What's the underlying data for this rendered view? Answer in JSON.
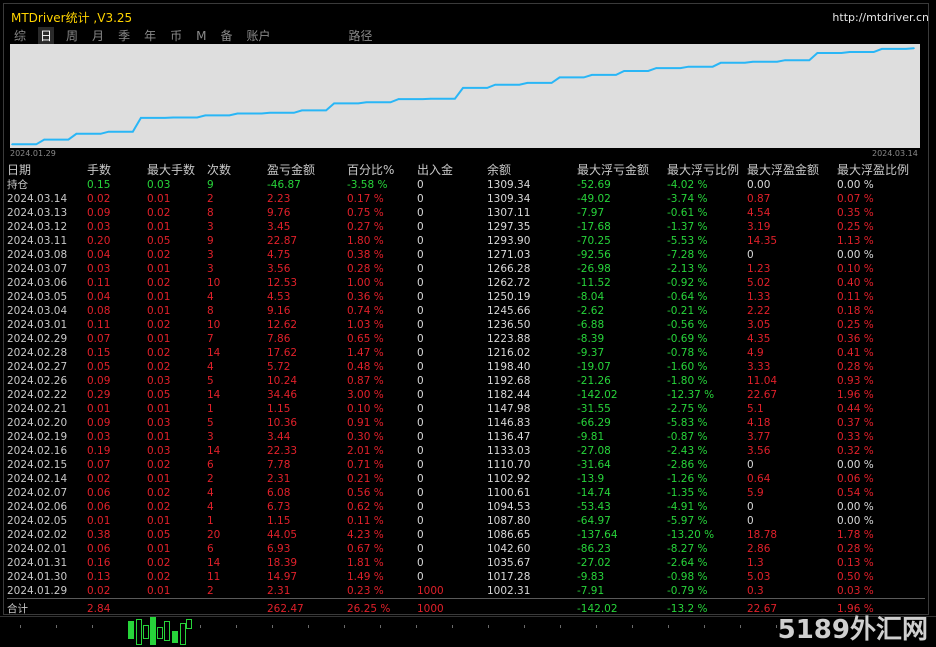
{
  "app": {
    "title": "MTDriver统计 ,V3.25",
    "url": "http://mtdriver.cn"
  },
  "tabs": [
    {
      "label": "综",
      "active": false
    },
    {
      "label": "日",
      "active": true
    },
    {
      "label": "周",
      "active": false
    },
    {
      "label": "月",
      "active": false
    },
    {
      "label": "季",
      "active": false
    },
    {
      "label": "年",
      "active": false
    },
    {
      "label": "币",
      "active": false
    },
    {
      "label": "M",
      "active": false
    },
    {
      "label": "备",
      "active": false
    },
    {
      "label": "账户",
      "active": false
    },
    {
      "label": "路径",
      "active": false
    }
  ],
  "chart": {
    "start_label": "2024.01.29",
    "end_label": "2024.03.14",
    "line_color": "#29b6f6"
  },
  "chart_data": {
    "type": "line",
    "x": [
      "2024.01.29",
      "2024.01.30",
      "2024.01.31",
      "2024.02.01",
      "2024.02.02",
      "2024.02.05",
      "2024.02.06",
      "2024.02.07",
      "2024.02.14",
      "2024.02.15",
      "2024.02.16",
      "2024.02.19",
      "2024.02.20",
      "2024.02.21",
      "2024.02.22",
      "2024.02.26",
      "2024.02.27",
      "2024.02.28",
      "2024.02.29",
      "2024.03.01",
      "2024.03.04",
      "2024.03.05",
      "2024.03.06",
      "2024.03.07",
      "2024.03.08",
      "2024.03.11",
      "2024.03.12",
      "2024.03.13",
      "2024.03.14"
    ],
    "series": [
      {
        "values": [
          1002.31,
          1017.28,
          1035.67,
          1042.6,
          1086.65,
          1087.8,
          1094.53,
          1100.61,
          1102.92,
          1110.7,
          1133.03,
          1136.47,
          1146.83,
          1147.98,
          1182.44,
          1192.68,
          1198.4,
          1216.02,
          1223.88,
          1236.5,
          1245.66,
          1250.19,
          1262.72,
          1266.28,
          1271.03,
          1293.9,
          1297.35,
          1307.11,
          1309.34
        ]
      }
    ]
  },
  "columns": [
    "日期",
    "手数",
    "最大手数",
    "次数",
    "盈亏金额",
    "百分比%",
    "出入金",
    "余额",
    "最大浮亏金额",
    "最大浮亏比例",
    "最大浮盈金额",
    "最大浮盈比例"
  ],
  "colors": {
    "red": "#e0202a",
    "green": "#27d43a",
    "white": "#d8d8d8"
  },
  "holding": [
    "持仓",
    "0.15",
    "0.03",
    "9",
    "-46.87",
    "-3.58 %",
    "0",
    "1309.34",
    "-52.69",
    "-4.02 %",
    "0.00",
    "0.00 %"
  ],
  "rows": [
    [
      "2024.03.14",
      "0.02",
      "0.01",
      "2",
      "2.23",
      "0.17 %",
      "0",
      "1309.34",
      "-49.02",
      "-3.74 %",
      "0.87",
      "0.07 %"
    ],
    [
      "2024.03.13",
      "0.09",
      "0.02",
      "8",
      "9.76",
      "0.75 %",
      "0",
      "1307.11",
      "-7.97",
      "-0.61 %",
      "4.54",
      "0.35 %"
    ],
    [
      "2024.03.12",
      "0.03",
      "0.01",
      "3",
      "3.45",
      "0.27 %",
      "0",
      "1297.35",
      "-17.68",
      "-1.37 %",
      "3.19",
      "0.25 %"
    ],
    [
      "2024.03.11",
      "0.20",
      "0.05",
      "9",
      "22.87",
      "1.80 %",
      "0",
      "1293.90",
      "-70.25",
      "-5.53 %",
      "14.35",
      "1.13 %"
    ],
    [
      "2024.03.08",
      "0.04",
      "0.02",
      "3",
      "4.75",
      "0.38 %",
      "0",
      "1271.03",
      "-92.56",
      "-7.28 %",
      "0",
      "0.00 %"
    ],
    [
      "2024.03.07",
      "0.03",
      "0.01",
      "3",
      "3.56",
      "0.28 %",
      "0",
      "1266.28",
      "-26.98",
      "-2.13 %",
      "1.23",
      "0.10 %"
    ],
    [
      "2024.03.06",
      "0.11",
      "0.02",
      "10",
      "12.53",
      "1.00 %",
      "0",
      "1262.72",
      "-11.52",
      "-0.92 %",
      "5.02",
      "0.40 %"
    ],
    [
      "2024.03.05",
      "0.04",
      "0.01",
      "4",
      "4.53",
      "0.36 %",
      "0",
      "1250.19",
      "-8.04",
      "-0.64 %",
      "1.33",
      "0.11 %"
    ],
    [
      "2024.03.04",
      "0.08",
      "0.01",
      "8",
      "9.16",
      "0.74 %",
      "0",
      "1245.66",
      "-2.62",
      "-0.21 %",
      "2.22",
      "0.18 %"
    ],
    [
      "2024.03.01",
      "0.11",
      "0.02",
      "10",
      "12.62",
      "1.03 %",
      "0",
      "1236.50",
      "-6.88",
      "-0.56 %",
      "3.05",
      "0.25 %"
    ],
    [
      "2024.02.29",
      "0.07",
      "0.01",
      "7",
      "7.86",
      "0.65 %",
      "0",
      "1223.88",
      "-8.39",
      "-0.69 %",
      "4.35",
      "0.36 %"
    ],
    [
      "2024.02.28",
      "0.15",
      "0.02",
      "14",
      "17.62",
      "1.47 %",
      "0",
      "1216.02",
      "-9.37",
      "-0.78 %",
      "4.9",
      "0.41 %"
    ],
    [
      "2024.02.27",
      "0.05",
      "0.02",
      "4",
      "5.72",
      "0.48 %",
      "0",
      "1198.40",
      "-19.07",
      "-1.60 %",
      "3.33",
      "0.28 %"
    ],
    [
      "2024.02.26",
      "0.09",
      "0.03",
      "5",
      "10.24",
      "0.87 %",
      "0",
      "1192.68",
      "-21.26",
      "-1.80 %",
      "11.04",
      "0.93 %"
    ],
    [
      "2024.02.22",
      "0.29",
      "0.05",
      "14",
      "34.46",
      "3.00 %",
      "0",
      "1182.44",
      "-142.02",
      "-12.37 %",
      "22.67",
      "1.96 %"
    ],
    [
      "2024.02.21",
      "0.01",
      "0.01",
      "1",
      "1.15",
      "0.10 %",
      "0",
      "1147.98",
      "-31.55",
      "-2.75 %",
      "5.1",
      "0.44 %"
    ],
    [
      "2024.02.20",
      "0.09",
      "0.03",
      "5",
      "10.36",
      "0.91 %",
      "0",
      "1146.83",
      "-66.29",
      "-5.83 %",
      "4.18",
      "0.37 %"
    ],
    [
      "2024.02.19",
      "0.03",
      "0.01",
      "3",
      "3.44",
      "0.30 %",
      "0",
      "1136.47",
      "-9.81",
      "-0.87 %",
      "3.77",
      "0.33 %"
    ],
    [
      "2024.02.16",
      "0.19",
      "0.03",
      "14",
      "22.33",
      "2.01 %",
      "0",
      "1133.03",
      "-27.08",
      "-2.43 %",
      "3.56",
      "0.32 %"
    ],
    [
      "2024.02.15",
      "0.07",
      "0.02",
      "6",
      "7.78",
      "0.71 %",
      "0",
      "1110.70",
      "-31.64",
      "-2.86 %",
      "0",
      "0.00 %"
    ],
    [
      "2024.02.14",
      "0.02",
      "0.01",
      "2",
      "2.31",
      "0.21 %",
      "0",
      "1102.92",
      "-13.9",
      "-1.26 %",
      "0.64",
      "0.06 %"
    ],
    [
      "2024.02.07",
      "0.06",
      "0.02",
      "4",
      "6.08",
      "0.56 %",
      "0",
      "1100.61",
      "-14.74",
      "-1.35 %",
      "5.9",
      "0.54 %"
    ],
    [
      "2024.02.06",
      "0.06",
      "0.02",
      "4",
      "6.73",
      "0.62 %",
      "0",
      "1094.53",
      "-53.43",
      "-4.91 %",
      "0",
      "0.00 %"
    ],
    [
      "2024.02.05",
      "0.01",
      "0.01",
      "1",
      "1.15",
      "0.11 %",
      "0",
      "1087.80",
      "-64.97",
      "-5.97 %",
      "0",
      "0.00 %"
    ],
    [
      "2024.02.02",
      "0.38",
      "0.05",
      "20",
      "44.05",
      "4.23 %",
      "0",
      "1086.65",
      "-137.64",
      "-13.20 %",
      "18.78",
      "1.78 %"
    ],
    [
      "2024.02.01",
      "0.06",
      "0.01",
      "6",
      "6.93",
      "0.67 %",
      "0",
      "1042.60",
      "-86.23",
      "-8.27 %",
      "2.86",
      "0.28 %"
    ],
    [
      "2024.01.31",
      "0.16",
      "0.02",
      "14",
      "18.39",
      "1.81 %",
      "0",
      "1035.67",
      "-27.02",
      "-2.64 %",
      "1.3",
      "0.13 %"
    ],
    [
      "2024.01.30",
      "0.13",
      "0.02",
      "11",
      "14.97",
      "1.49 %",
      "0",
      "1017.28",
      "-9.83",
      "-0.98 %",
      "5.03",
      "0.50 %"
    ],
    [
      "2024.01.29",
      "0.02",
      "0.01",
      "2",
      "2.31",
      "0.23 %",
      "1000",
      "1002.31",
      "-7.91",
      "-0.79 %",
      "0.3",
      "0.03 %"
    ]
  ],
  "total": [
    "合计",
    "2.84",
    "",
    "",
    "262.47",
    "26.25 %",
    "1000",
    "",
    "-142.02",
    "-13.2 %",
    "22.67",
    "1.96 %"
  ],
  "watermark": "5189外汇网"
}
